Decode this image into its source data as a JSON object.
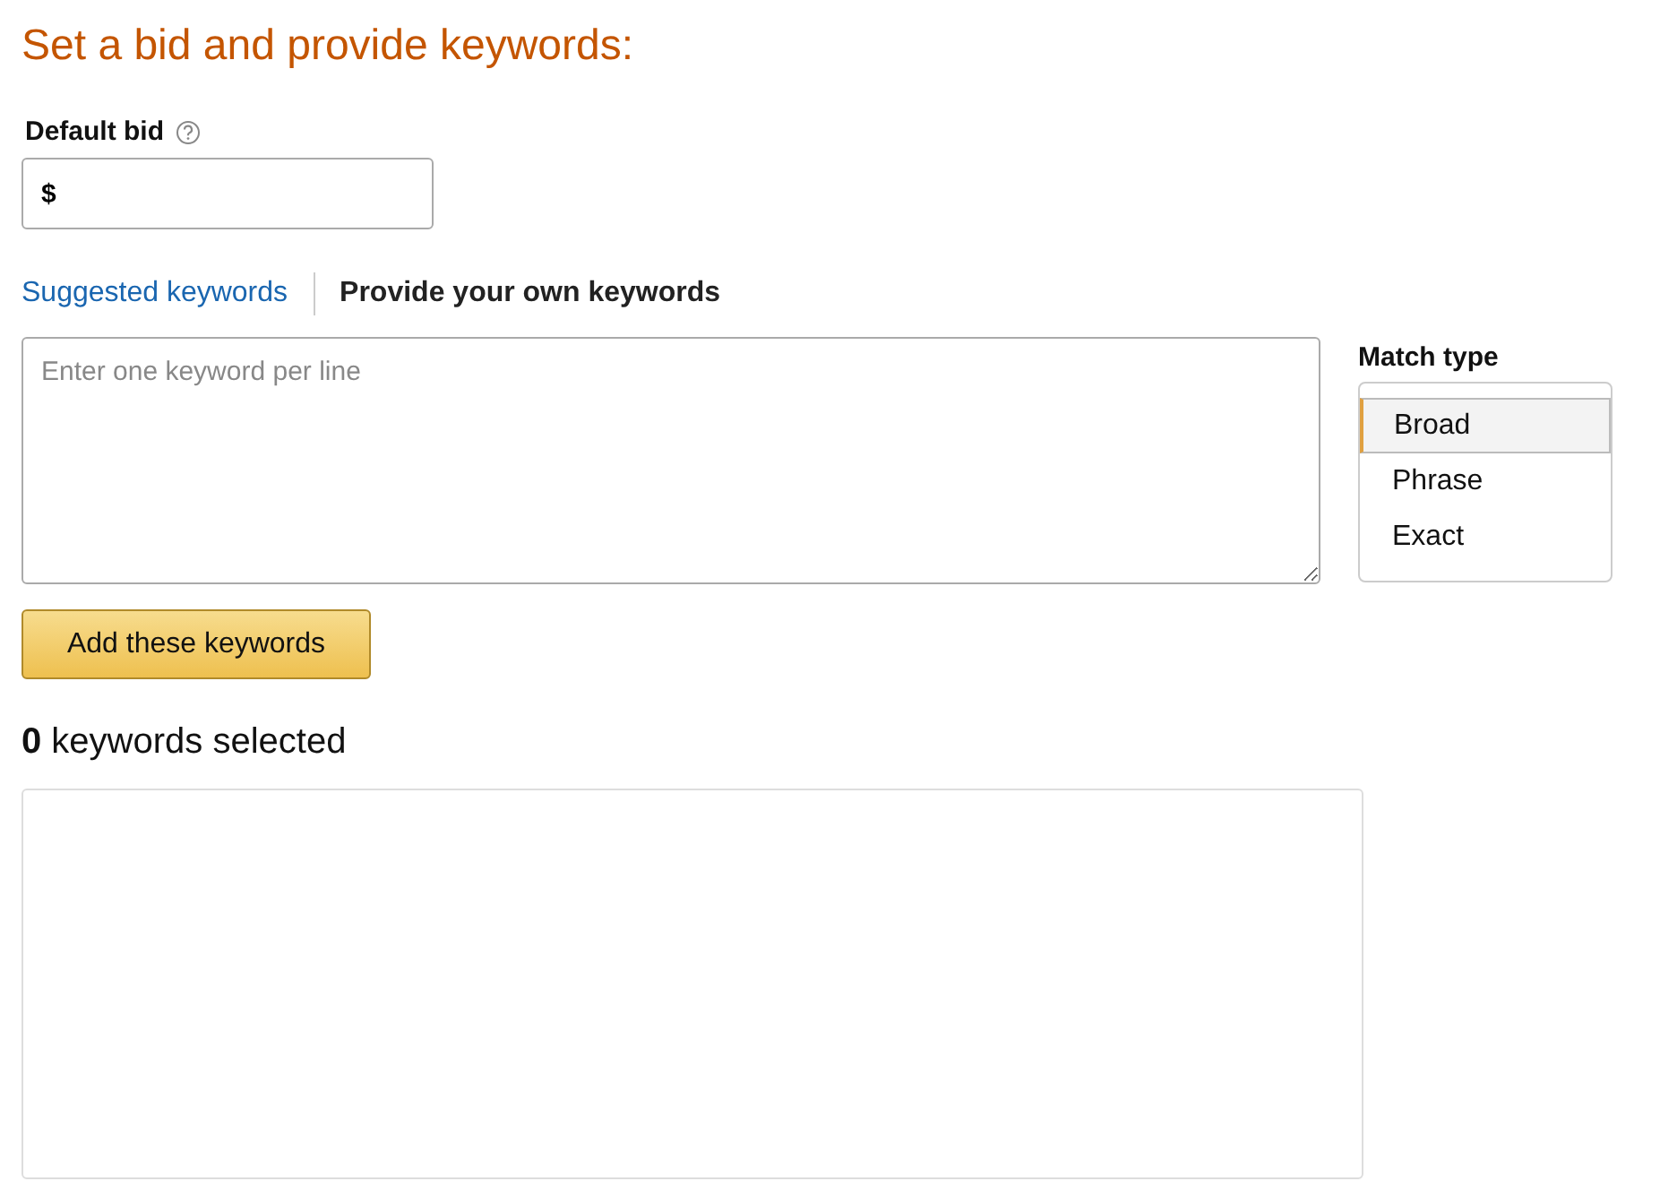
{
  "heading": "Set a bid and provide keywords:",
  "default_bid": {
    "label": "Default bid",
    "value": "$"
  },
  "tabs": [
    {
      "label": "Suggested keywords",
      "selected": false
    },
    {
      "label": "Provide your own keywords",
      "selected": true
    }
  ],
  "keywords_field": {
    "placeholder": "Enter one keyword per line"
  },
  "match_type": {
    "label": "Match type",
    "options": [
      {
        "label": "Broad",
        "selected": true
      },
      {
        "label": "Phrase",
        "selected": false
      },
      {
        "label": "Exact",
        "selected": false
      }
    ]
  },
  "add_button": "Add these keywords",
  "selected_count": "**0** keywords selected"
}
